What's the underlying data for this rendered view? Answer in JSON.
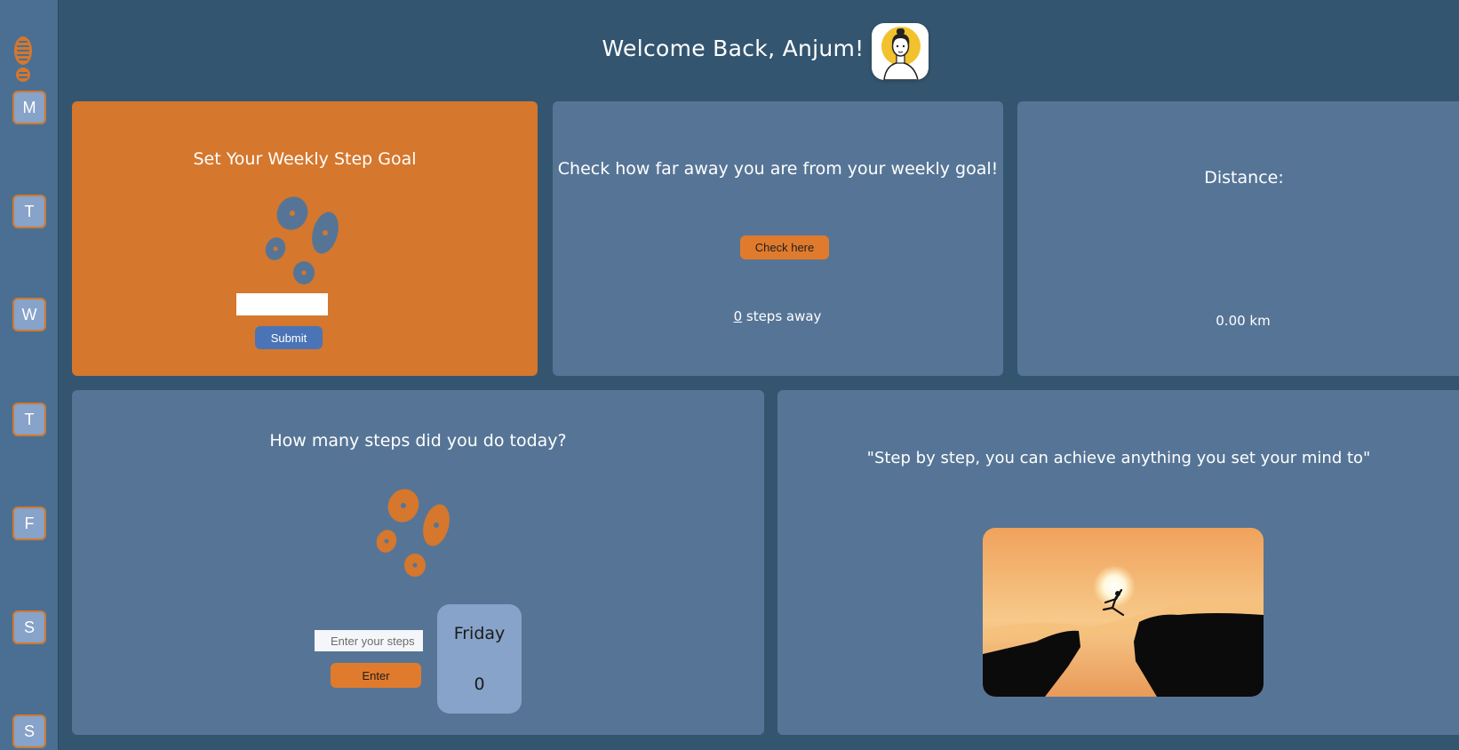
{
  "header": {
    "welcome": "Welcome Back, Anjum!"
  },
  "sidebar": {
    "days": [
      "M",
      "T",
      "W",
      "T",
      "F",
      "S",
      "S"
    ]
  },
  "goal_card": {
    "title": "Set Your Weekly Step Goal",
    "input_value": "",
    "submit_label": "Submit"
  },
  "check_card": {
    "title": "Check how far away you are from your weekly goal!",
    "button_label": "Check here",
    "steps_value": "0",
    "steps_suffix": " steps away"
  },
  "distance_card": {
    "title": "Distance:",
    "value": "0.00 km"
  },
  "today_card": {
    "title": "How many steps did you do today?",
    "input_placeholder": "Enter your steps",
    "enter_label": "Enter",
    "day_name": "Friday",
    "day_count": "0"
  },
  "quote_card": {
    "quote": "\"Step by step, you can achieve anything you set your mind to\""
  },
  "colors": {
    "background": "#34556f",
    "card": "#567596",
    "accent_orange": "#d5772d",
    "button_blue": "#4a74b6",
    "day_box": "#87a3c9"
  },
  "icons": [
    "footprints-logo-icon",
    "footprints-icon",
    "avatar-icon"
  ]
}
